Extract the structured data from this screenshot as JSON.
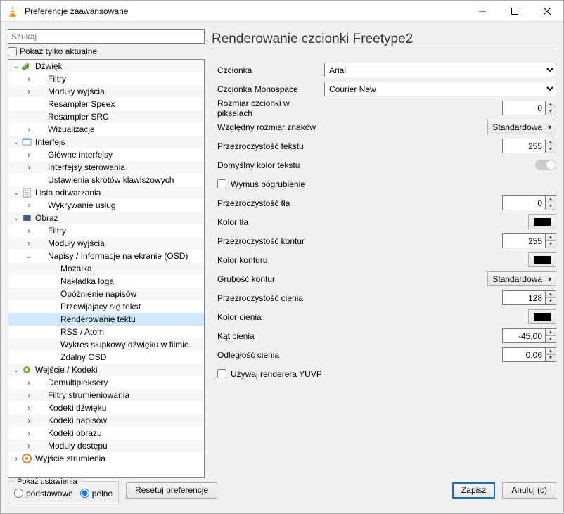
{
  "titlebar": {
    "title": "Preferencje zaawansowane"
  },
  "left": {
    "search_placeholder": "Szukaj",
    "show_current_only": "Pokaż tylko aktualne",
    "tree": [
      {
        "depth": 0,
        "arrow": "expanded",
        "icon": "audio",
        "label": "Dźwięk"
      },
      {
        "depth": 1,
        "arrow": "collapsed",
        "icon": "",
        "label": "Filtry"
      },
      {
        "depth": 1,
        "arrow": "collapsed",
        "icon": "",
        "label": "Moduły wyjścia"
      },
      {
        "depth": 1,
        "arrow": "none",
        "icon": "",
        "label": "Resampler Speex"
      },
      {
        "depth": 1,
        "arrow": "none",
        "icon": "",
        "label": "Resampler SRC"
      },
      {
        "depth": 1,
        "arrow": "collapsed",
        "icon": "",
        "label": "Wizualizacje"
      },
      {
        "depth": 0,
        "arrow": "expanded",
        "icon": "interface",
        "label": "Interfejs"
      },
      {
        "depth": 1,
        "arrow": "collapsed",
        "icon": "",
        "label": "Główne interfejsy"
      },
      {
        "depth": 1,
        "arrow": "collapsed",
        "icon": "",
        "label": "Interfejsy sterowania"
      },
      {
        "depth": 1,
        "arrow": "none",
        "icon": "",
        "label": "Ustawienia skrótów klawiszowych"
      },
      {
        "depth": 0,
        "arrow": "expanded",
        "icon": "playlist",
        "label": "Lista odtwarzania"
      },
      {
        "depth": 1,
        "arrow": "collapsed",
        "icon": "",
        "label": "Wykrywanie usług"
      },
      {
        "depth": 0,
        "arrow": "expanded",
        "icon": "video",
        "label": "Obraz"
      },
      {
        "depth": 1,
        "arrow": "collapsed",
        "icon": "",
        "label": "Filtry"
      },
      {
        "depth": 1,
        "arrow": "collapsed",
        "icon": "",
        "label": "Moduły wyjścia"
      },
      {
        "depth": 1,
        "arrow": "expanded",
        "icon": "",
        "label": "Napisy / Informacje na ekranie (OSD)"
      },
      {
        "depth": 2,
        "arrow": "none",
        "icon": "",
        "label": "Mozaika"
      },
      {
        "depth": 2,
        "arrow": "none",
        "icon": "",
        "label": "Nakładka loga"
      },
      {
        "depth": 2,
        "arrow": "none",
        "icon": "",
        "label": "Opóźnienie napisów"
      },
      {
        "depth": 2,
        "arrow": "none",
        "icon": "",
        "label": "Przewijający się tekst"
      },
      {
        "depth": 2,
        "arrow": "none",
        "icon": "",
        "label": "Renderowanie tektu",
        "selected": true
      },
      {
        "depth": 2,
        "arrow": "none",
        "icon": "",
        "label": "RSS / Atom"
      },
      {
        "depth": 2,
        "arrow": "none",
        "icon": "",
        "label": "Wykres słupkowy dźwięku w filmie"
      },
      {
        "depth": 2,
        "arrow": "none",
        "icon": "",
        "label": "Zdalny OSD"
      },
      {
        "depth": 0,
        "arrow": "expanded",
        "icon": "codec",
        "label": "Wejście / Kodeki"
      },
      {
        "depth": 1,
        "arrow": "collapsed",
        "icon": "",
        "label": "Demultipleksery"
      },
      {
        "depth": 1,
        "arrow": "collapsed",
        "icon": "",
        "label": "Filtry strumieniowania"
      },
      {
        "depth": 1,
        "arrow": "collapsed",
        "icon": "",
        "label": "Kodeki dźwięku"
      },
      {
        "depth": 1,
        "arrow": "collapsed",
        "icon": "",
        "label": "Kodeki napisów"
      },
      {
        "depth": 1,
        "arrow": "collapsed",
        "icon": "",
        "label": "Kodeki obrazu"
      },
      {
        "depth": 1,
        "arrow": "collapsed",
        "icon": "",
        "label": "Moduły dostępu"
      },
      {
        "depth": 0,
        "arrow": "collapsed",
        "icon": "stream",
        "label": "Wyjście strumienia"
      }
    ]
  },
  "right": {
    "title": "Renderowanie czcionki Freetype2",
    "font_label": "Czcionka",
    "font_value": "Arial",
    "mono_label": "Czcionka Monospace",
    "mono_value": "Courier New",
    "size_label": "Rozmiar czcionki w pikselach",
    "size_value": "0",
    "relsize_label": "Względny rozmiar znaków",
    "relsize_value": "Standardowa",
    "textop_label": "Przezroczystość tekstu",
    "textop_value": "255",
    "defcolor_label": "Domyślny kolor tekstu",
    "forcebold_label": "Wymuś pogrubienie",
    "bgop_label": "Przezroczystość tła",
    "bgop_value": "0",
    "bgcolor_label": "Kolor tła",
    "bgcolor_value": "#000000",
    "outop_label": "Przezroczystość kontur",
    "outop_value": "255",
    "outcolor_label": "Kolor konturu",
    "outcolor_value": "#000000",
    "outthick_label": "Grubość kontur",
    "outthick_value": "Standardowa",
    "shop_label": "Przezroczystość cienia",
    "shop_value": "128",
    "shcolor_label": "Kolor cienia",
    "shcolor_value": "#000000",
    "shangle_label": "Kąt cienia",
    "shangle_value": "-45,00",
    "shdist_label": "Odległość cienia",
    "shdist_value": "0,06",
    "yuvp_label": "Używaj renderera YUVP"
  },
  "footer": {
    "show_settings": "Pokaż ustawienia",
    "basic": "podstawowe",
    "full": "pełne",
    "reset": "Resetuj preferencje",
    "save": "Zapisz",
    "cancel": "Anuluj (c)"
  }
}
